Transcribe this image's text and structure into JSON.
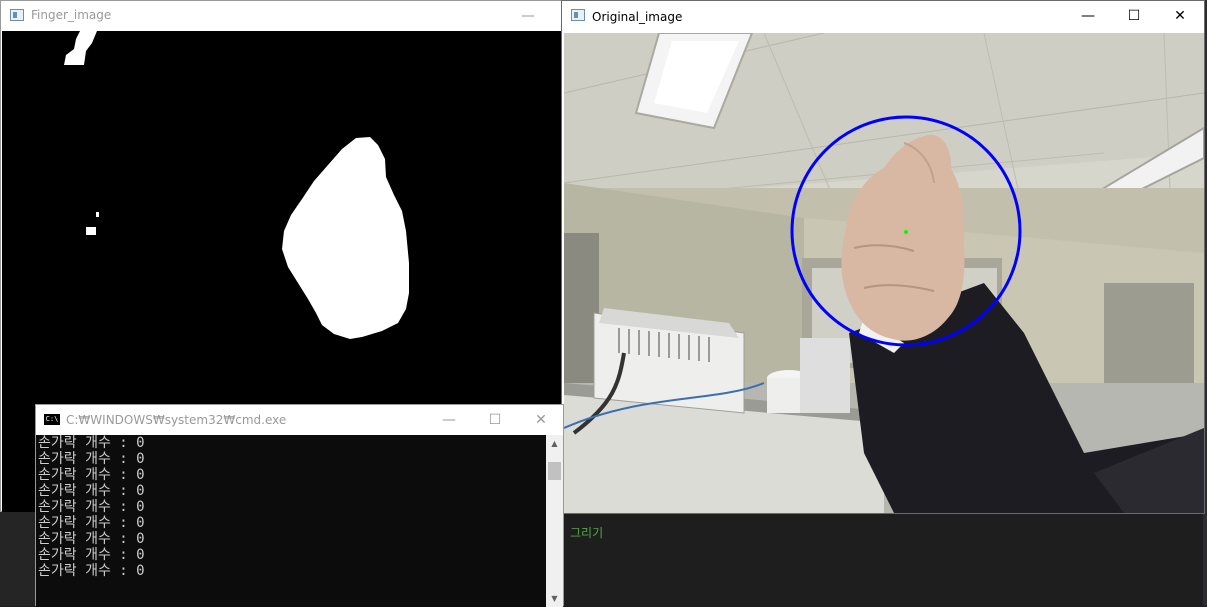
{
  "finger_window": {
    "title": "Finger_image",
    "minimize": "—"
  },
  "original_window": {
    "title": "Original_image",
    "minimize": "—",
    "maximize": "☐",
    "close": "✕"
  },
  "cmd_window": {
    "title": "C:₩WINDOWS₩system32₩cmd.exe",
    "minimize": "—",
    "maximize": "☐",
    "close": "✕",
    "lines": [
      "손가락 개수 : 0",
      "손가락 개수 : 0",
      "손가락 개수 : 0",
      "손가락 개수 : 0",
      "손가락 개수 : 0",
      "손가락 개수 : 0",
      "손가락 개수 : 0",
      "손가락 개수 : 0",
      "손가락 개수 : 0"
    ]
  },
  "editor": {
    "comment_text": "그리기"
  },
  "colors": {
    "circle": "#0000ff",
    "center_point": "#00ff00",
    "cmd_bg": "#0c0c0c",
    "cmd_text": "#cccccc",
    "editor_comment": "#57a64a"
  },
  "icons": {
    "app_icon": "window-app-icon",
    "cmd_icon": "cmd-icon"
  }
}
